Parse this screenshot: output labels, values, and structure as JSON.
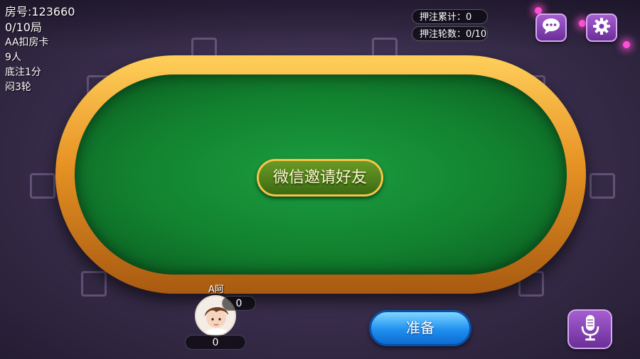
{
  "room_info": {
    "room_number": "房号:123660",
    "rounds": "0/10局",
    "payment": "AA扣房卡",
    "players": "9人",
    "base_bet": "底注1分",
    "blind_rounds": "闷3轮"
  },
  "bet_stats": {
    "total_bet": "押注累计：0",
    "bet_rounds": "押注轮数：0/10"
  },
  "icons": {
    "chat": "chat-bubble-icon",
    "settings": "gear-icon",
    "voice": "microphone-icon"
  },
  "buttons": {
    "invite": "微信邀请好友",
    "ready": "准备"
  },
  "player": {
    "name": "A阿",
    "score": "0",
    "bet": "0"
  },
  "colors": {
    "felt": "#12812f",
    "rim": "#e79325",
    "ready_button": "#1f8ff0",
    "purple_button": "#8a45b8"
  }
}
